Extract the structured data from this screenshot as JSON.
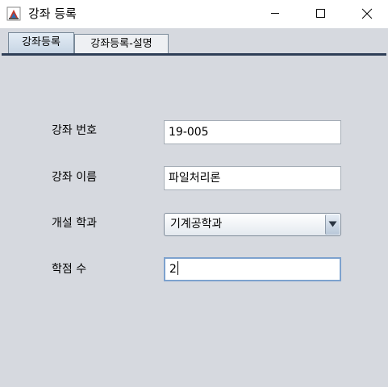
{
  "window": {
    "title": "강좌 등록",
    "buttons": [
      "minimize",
      "maximize",
      "close"
    ]
  },
  "tabs": [
    {
      "label": "강좌등록",
      "selected": true
    },
    {
      "label": "강좌등록-설명",
      "selected": false
    }
  ],
  "form": {
    "course_number": {
      "label": "강좌 번호",
      "value": "19-005"
    },
    "course_name": {
      "label": "강좌 이름",
      "value": "파일처리론"
    },
    "department": {
      "label": "개설 학과",
      "selected": "기계공학과"
    },
    "credits": {
      "label": "학점 수",
      "value": "2",
      "focused": true
    }
  },
  "icons": {
    "app": "java-cup-icon",
    "minimize": "minimize-icon",
    "maximize": "maximize-icon",
    "close": "close-icon",
    "dropdown": "dropdown-arrow-icon"
  },
  "colors": {
    "content_background": "#d6d9df",
    "tab_underline": "#2f3f57",
    "focus_border": "#7da2ce"
  }
}
